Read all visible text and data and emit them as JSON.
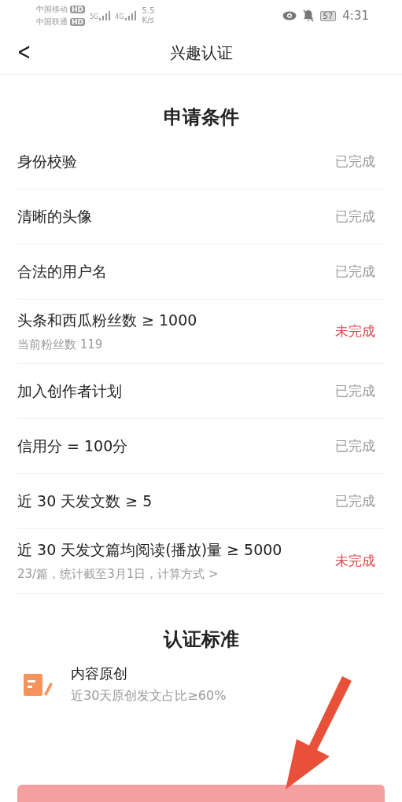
{
  "status_bar": {
    "carriers": [
      {
        "name": "中国移动",
        "badge": "HD"
      },
      {
        "name": "中国联通",
        "badge": "HD"
      }
    ],
    "networks": [
      "5G",
      "4G"
    ],
    "speed": "5.5",
    "speed_unit": "K/s",
    "battery": "57",
    "time": "4:31"
  },
  "header": {
    "back": "<",
    "title": "兴趣认证"
  },
  "conditions": {
    "title": "申请条件",
    "rows": [
      {
        "label": "身份校验",
        "status": "已完成",
        "completed": true
      },
      {
        "label": "清晰的头像",
        "status": "已完成",
        "completed": true
      },
      {
        "label": "合法的用户名",
        "status": "已完成",
        "completed": true
      },
      {
        "label": "头条和西瓜粉丝数 ≥ 1000",
        "detail": "当前粉丝数 119",
        "status": "未完成",
        "completed": false
      },
      {
        "label": "加入创作者计划",
        "status": "已完成",
        "completed": true
      },
      {
        "label": "信用分 = 100分",
        "status": "已完成",
        "completed": true
      },
      {
        "label": "近 30 天发文数 ≥ 5",
        "status": "已完成",
        "completed": true
      },
      {
        "label": "近 30 天发文篇均阅读(播放)量 ≥ 5000",
        "detail": "23/篇，统计截至3月1日，计算方式 >",
        "status": "未完成",
        "completed": false
      }
    ]
  },
  "standards": {
    "title": "认证标准",
    "items": [
      {
        "title": "内容原创",
        "detail": "近30天原创发文占比≥60%"
      }
    ]
  }
}
